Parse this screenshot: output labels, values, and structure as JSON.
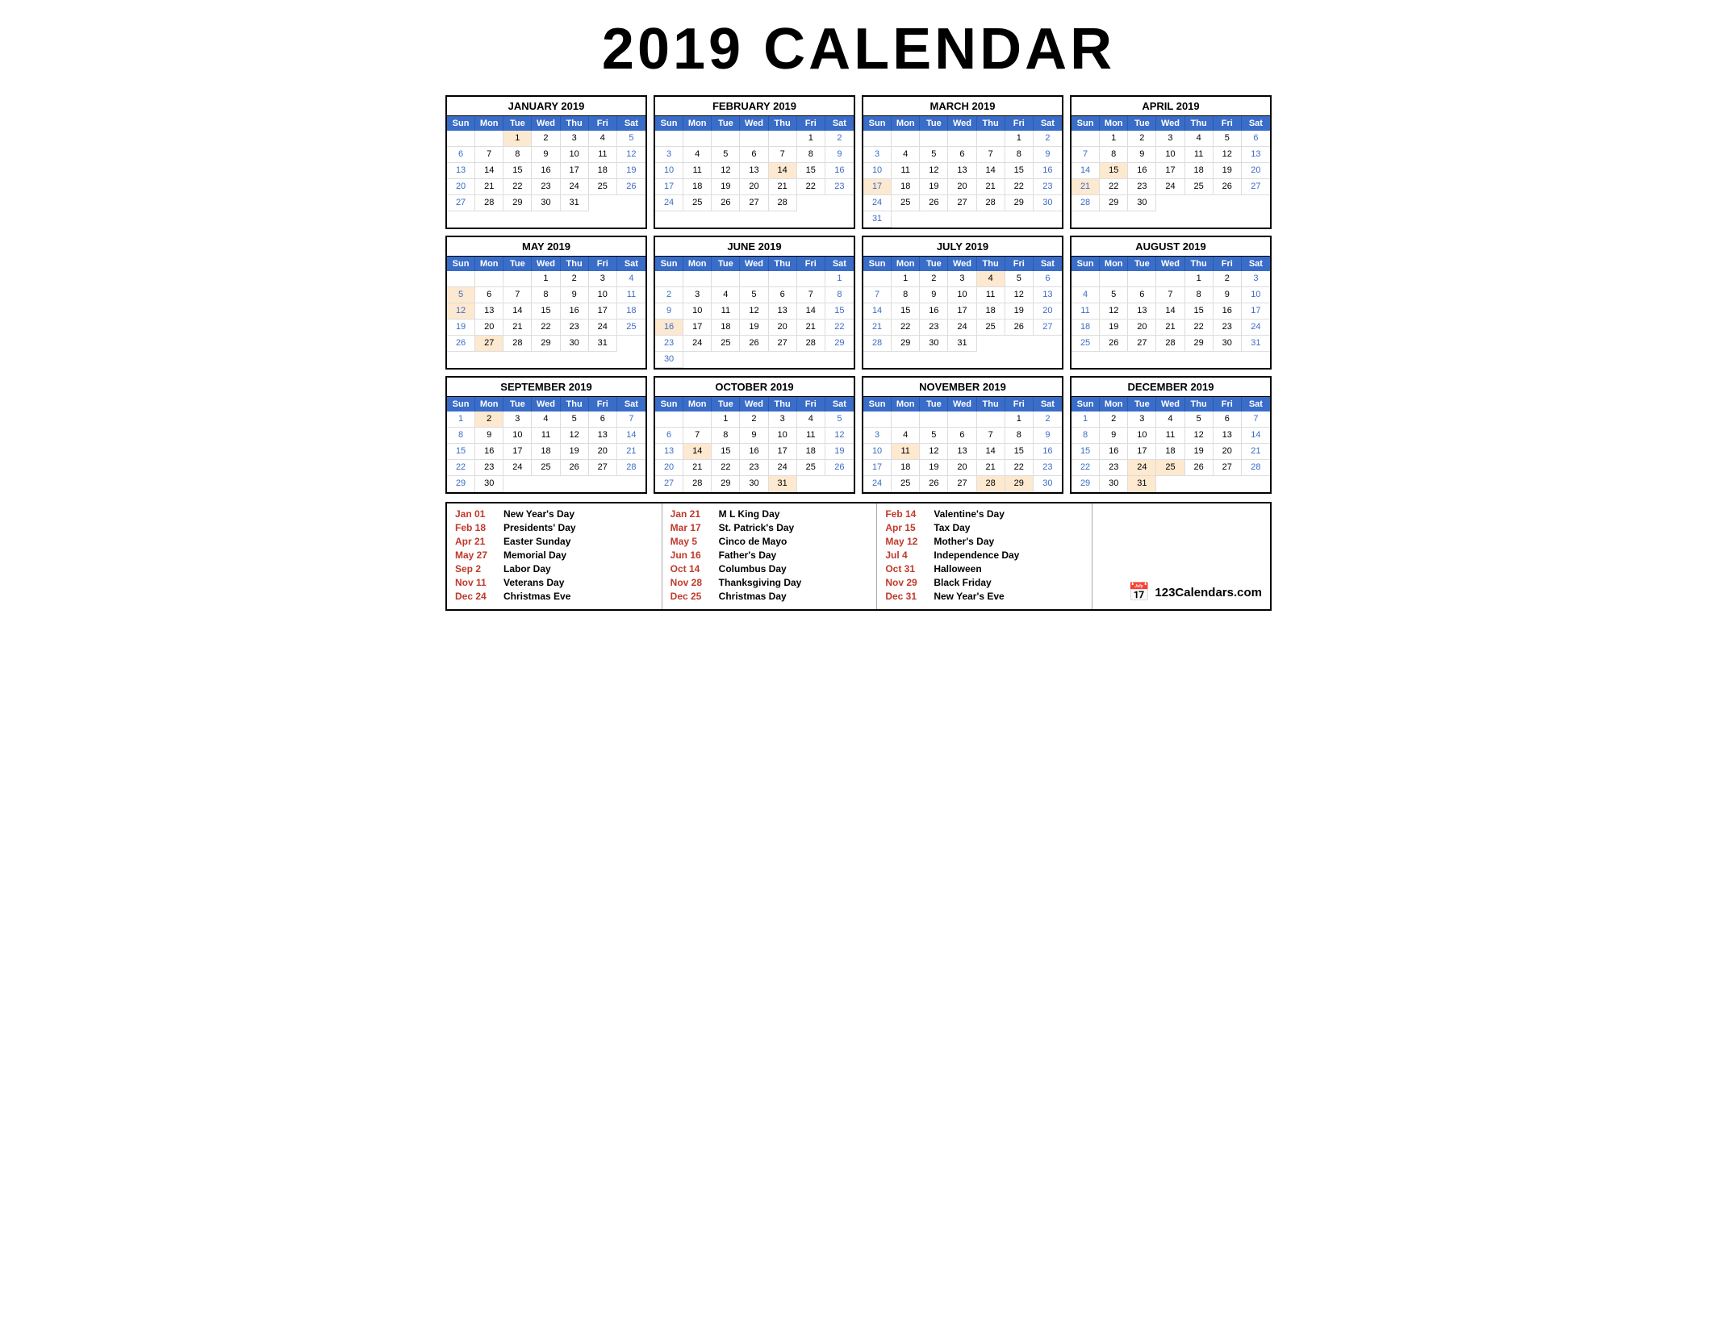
{
  "title": "2019 CALENDAR",
  "months": [
    {
      "name": "JANUARY 2019",
      "startDay": 2,
      "days": 31,
      "highlights": [
        1
      ]
    },
    {
      "name": "FEBRUARY 2019",
      "startDay": 5,
      "days": 28,
      "highlights": [
        14
      ]
    },
    {
      "name": "MARCH 2019",
      "startDay": 5,
      "days": 31,
      "highlights": [
        17
      ]
    },
    {
      "name": "APRIL 2019",
      "startDay": 1,
      "days": 30,
      "highlights": [
        15,
        21
      ]
    },
    {
      "name": "MAY 2019",
      "startDay": 3,
      "days": 31,
      "highlights": [
        5,
        12,
        27
      ]
    },
    {
      "name": "JUNE 2019",
      "startDay": 6,
      "days": 30,
      "highlights": [
        16
      ]
    },
    {
      "name": "JULY 2019",
      "startDay": 1,
      "days": 31,
      "highlights": [
        4
      ]
    },
    {
      "name": "AUGUST 2019",
      "startDay": 4,
      "days": 31,
      "highlights": []
    },
    {
      "name": "SEPTEMBER 2019",
      "startDay": 0,
      "days": 30,
      "highlights": [
        2
      ]
    },
    {
      "name": "OCTOBER 2019",
      "startDay": 2,
      "days": 31,
      "highlights": [
        14,
        31
      ]
    },
    {
      "name": "NOVEMBER 2019",
      "startDay": 5,
      "days": 30,
      "highlights": [
        11,
        28,
        29
      ]
    },
    {
      "name": "DECEMBER 2019",
      "startDay": 0,
      "days": 31,
      "highlights": [
        24,
        25,
        31
      ]
    }
  ],
  "dayHeaders": [
    "Sun",
    "Mon",
    "Tue",
    "Wed",
    "Thu",
    "Fri",
    "Sat"
  ],
  "holidays": {
    "col1": [
      {
        "date": "Jan 01",
        "name": "New Year's Day"
      },
      {
        "date": "Feb 18",
        "name": "Presidents' Day"
      },
      {
        "date": "Apr 21",
        "name": "Easter Sunday"
      },
      {
        "date": "May 27",
        "name": "Memorial Day"
      },
      {
        "date": "Sep 2",
        "name": "Labor Day"
      },
      {
        "date": "Nov 11",
        "name": "Veterans Day"
      },
      {
        "date": "Dec 24",
        "name": "Christmas Eve"
      }
    ],
    "col2": [
      {
        "date": "Jan 21",
        "name": "M L King Day"
      },
      {
        "date": "Mar 17",
        "name": "St. Patrick's Day"
      },
      {
        "date": "May 5",
        "name": "Cinco de Mayo"
      },
      {
        "date": "Jun 16",
        "name": "Father's Day"
      },
      {
        "date": "Oct 14",
        "name": "Columbus Day"
      },
      {
        "date": "Nov 28",
        "name": "Thanksgiving Day"
      },
      {
        "date": "Dec 25",
        "name": "Christmas Day"
      }
    ],
    "col3": [
      {
        "date": "Feb 14",
        "name": "Valentine's Day"
      },
      {
        "date": "Apr 15",
        "name": "Tax Day"
      },
      {
        "date": "May 12",
        "name": "Mother's Day"
      },
      {
        "date": "Jul 4",
        "name": "Independence Day"
      },
      {
        "date": "Oct 31",
        "name": "Halloween"
      },
      {
        "date": "Nov 29",
        "name": "Black Friday"
      },
      {
        "date": "Dec 31",
        "name": "New Year's Eve"
      }
    ]
  },
  "branding": "123Calendars.com"
}
